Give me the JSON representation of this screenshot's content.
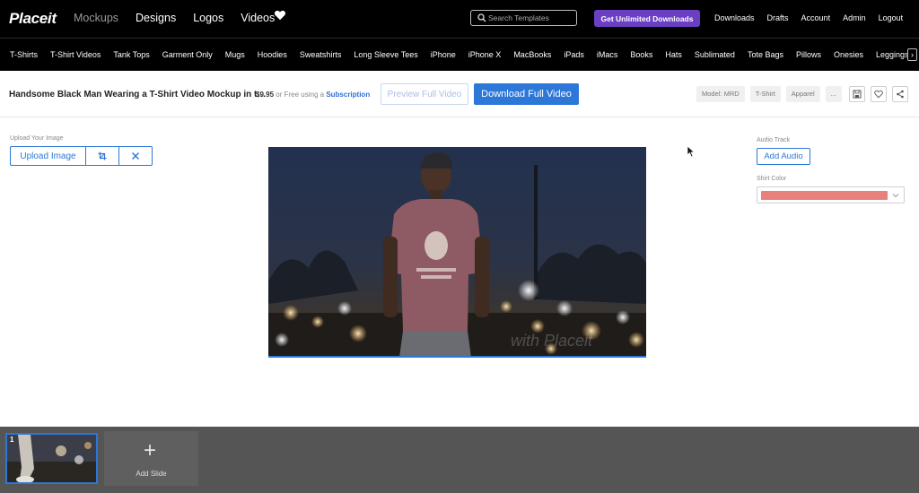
{
  "header": {
    "logo": "Placeit",
    "nav": [
      "Mockups",
      "Designs",
      "Logos",
      "Videos"
    ],
    "search_placeholder": "Search Templates",
    "unlimited_label": "Get Unlimited Downloads",
    "user_nav": [
      "Downloads",
      "Drafts",
      "Account",
      "Admin",
      "Logout"
    ]
  },
  "categories": [
    "T-Shirts",
    "T-Shirt Videos",
    "Tank Tops",
    "Garment Only",
    "Mugs",
    "Hoodies",
    "Sweatshirts",
    "Long Sleeve Tees",
    "iPhone",
    "iPhone X",
    "MacBooks",
    "iPads",
    "iMacs",
    "Books",
    "Hats",
    "Sublimated",
    "Tote Bags",
    "Pillows",
    "Onesies",
    "Leggings"
  ],
  "toolbar": {
    "title": "Handsome Black Man Wearing a T-Shirt Video Mockup in t…",
    "price": "$9.95",
    "price_or": "or Free using a",
    "subscription": "Subscription",
    "preview_label": "Preview Full Video",
    "download_label": "Download Full Video",
    "tags": [
      "Model: MRD",
      "T-Shirt",
      "Apparel",
      "..."
    ]
  },
  "upload": {
    "label": "Upload Your Image",
    "button": "Upload Image"
  },
  "right_panel": {
    "audio_label": "Audio Track",
    "add_audio": "Add Audio",
    "shirt_color_label": "Shirt Color",
    "shirt_color": "#e8807b"
  },
  "slides": {
    "thumb_number": "1",
    "add_slide": "Add Slide"
  },
  "colors": {
    "accent": "#2d77d8",
    "purple": "#6a3fc4"
  }
}
